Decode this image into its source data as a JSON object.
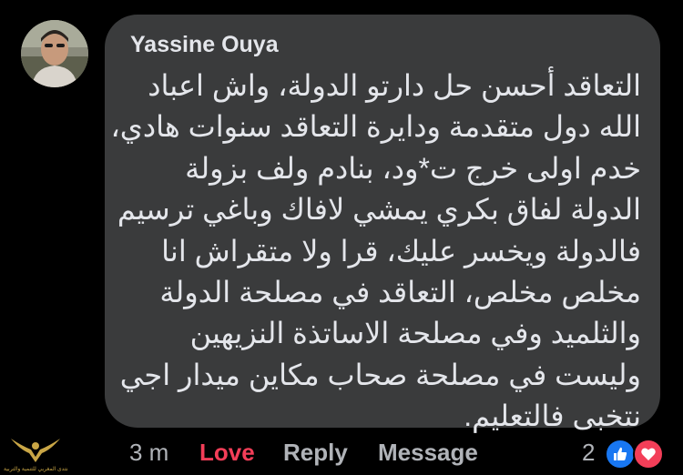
{
  "comment": {
    "author": "Yassine Ouya",
    "lines": [
      "التعاقد أحسن حل دارتو الدولة، واش اعباد",
      "الله دول متقدمة ودايرة التعاقد سنوات هادي،",
      "خدم اولى خرج ت*ود، بنادم ولف بزولة",
      "الدولة لفاق بكري يمشي لافاك وباغي ترسيم",
      "فالدولة ويخسر عليك، قرا ولا متقراش انا",
      "مخلص مخلص، التعاقد في مصلحة الدولة",
      "والثلميد وفي مصلحة الاساتذة النزيهين",
      "وليست في مصلحة صحاب مكاين ميدار اجي",
      "نتخبى فالتعليم."
    ]
  },
  "actions": {
    "time": "3 m",
    "love": "Love",
    "reply": "Reply",
    "message": "Message"
  },
  "reactions": {
    "count": "2",
    "icons": [
      "like-icon",
      "heart-icon"
    ]
  },
  "watermark": {
    "text": "المنتدى المغربي للتنمية والتربية"
  },
  "colors": {
    "background": "#000000",
    "bubble": "#3a3b3c",
    "text": "#e4e6eb",
    "muted": "#b0b3b8",
    "love": "#f33e58",
    "like": "#1877f2"
  }
}
